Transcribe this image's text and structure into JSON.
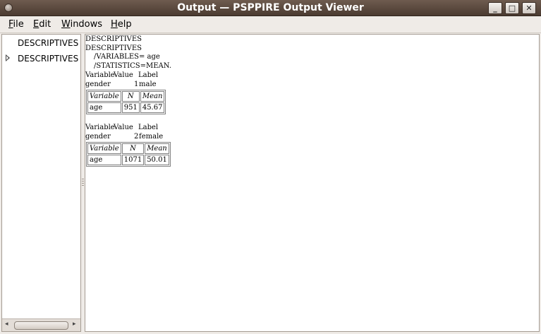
{
  "window": {
    "title": "Output — PSPPIRE Output Viewer",
    "buttons": {
      "minimize": "_",
      "maximize": "□",
      "close": "✕"
    }
  },
  "menu": [
    {
      "label": "File",
      "mnemonic": "F",
      "rest": "ile"
    },
    {
      "label": "Edit",
      "mnemonic": "E",
      "rest": "dit"
    },
    {
      "label": "Windows",
      "mnemonic": "W",
      "rest": "indows"
    },
    {
      "label": "Help",
      "mnemonic": "H",
      "rest": "elp"
    }
  ],
  "tree": {
    "items": [
      "DESCRIPTIVES",
      "DESCRIPTIVES"
    ]
  },
  "output": {
    "heading1": "DESCRIPTIVES",
    "heading2": "DESCRIPTIVES",
    "syntax1": "/VARIABLES= age",
    "syntax2": "/STATISTICS=MEAN.",
    "groups": [
      {
        "split_header": {
          "variable": "Variable",
          "value": "Value",
          "label": "Label"
        },
        "split_row": {
          "variable": "gender",
          "value": "1",
          "label": "male"
        },
        "columns": [
          "Variable",
          "N",
          "Mean"
        ],
        "row": {
          "variable": "age",
          "n": "951",
          "mean": "45.67"
        }
      },
      {
        "split_header": {
          "variable": "Variable",
          "value": "Value",
          "label": "Label"
        },
        "split_row": {
          "variable": "gender",
          "value": "2",
          "label": "female"
        },
        "columns": [
          "Variable",
          "N",
          "Mean"
        ],
        "row": {
          "variable": "age",
          "n": "1071",
          "mean": "50.01"
        }
      }
    ]
  },
  "icons": {
    "window_menu": "window-menu-icon",
    "expander": "triangle-right-icon",
    "scroll_left": "◂",
    "scroll_right": "▸"
  }
}
